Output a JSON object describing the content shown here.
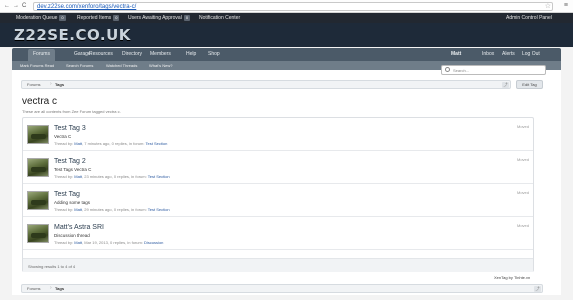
{
  "browser": {
    "url": "dev.z22se.com/xenforo/tags/vectra-c/",
    "back_glyph": "←",
    "forward_glyph": "→",
    "reload_glyph": "C",
    "bookmark_glyph": "☆",
    "menu_glyph": "≡"
  },
  "modbar": {
    "items": [
      {
        "label": "Moderation Queue",
        "count": "0"
      },
      {
        "label": "Reported Items",
        "count": "0"
      },
      {
        "label": "Users Awaiting Approval",
        "count": "0"
      },
      {
        "label": "Notification Center",
        "count": ""
      }
    ],
    "admin_label": "Admin Control Panel"
  },
  "header": {
    "logo": "Z22SE.CO.UK"
  },
  "nav": {
    "tabs": [
      "Forums",
      "Garage",
      "Resources",
      "Directory",
      "Members",
      "Help",
      "Shop"
    ],
    "active": "Forums",
    "user": "Matt",
    "user_links": [
      "Inbox",
      "Alerts",
      "Log Out"
    ]
  },
  "subnav": {
    "items": [
      "Mark Forums Read",
      "Search Forums",
      "Watched Threads",
      "What's New?"
    ]
  },
  "search": {
    "placeholder": "Search..."
  },
  "breadcrumb": {
    "items": [
      "Forums",
      "Tags"
    ]
  },
  "edit_tag_label": "Edit Tag",
  "page": {
    "title": "vectra c",
    "description": "These are all contents from Zee Forum tagged vectra c."
  },
  "results": [
    {
      "title": "Test Tag 3",
      "subtitle": "Vectra C",
      "meta_prefix": "Thread by: ",
      "author": "Matt",
      "meta_mid": ", 7 minutes ago, 0 replies, in forum: ",
      "forum": "Test Section",
      "status": "Moved"
    },
    {
      "title": "Test Tag 2",
      "subtitle": "Test Tags Vectra C",
      "meta_prefix": "Thread by: ",
      "author": "Matt",
      "meta_mid": ", 23 minutes ago, 0 replies, in forum: ",
      "forum": "Test Section",
      "status": "Moved"
    },
    {
      "title": "Test Tag",
      "subtitle": "Adding some tags",
      "meta_prefix": "Thread by: ",
      "author": "Matt",
      "meta_mid": ", 29 minutes ago, 0 replies, in forum: ",
      "forum": "Test Section",
      "status": "Moved"
    },
    {
      "title": "Matt's Astra SRI",
      "subtitle": "Discussion thread",
      "meta_prefix": "Thread by: ",
      "author": "Matt",
      "meta_mid": ", Mar 19, 2013, 0 replies, in forum: ",
      "forum": "Discussion",
      "status": "Moved"
    }
  ],
  "results_summary": "Showing results 1 to 4 of 4",
  "credit": "XenTag by Tinhte.vn"
}
